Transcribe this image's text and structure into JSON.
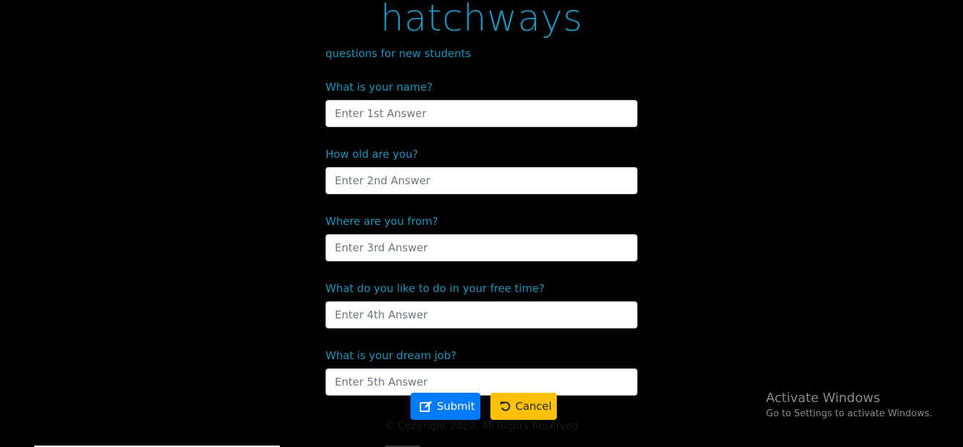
{
  "brand": {
    "title": "hatchways"
  },
  "form": {
    "subtitle": "questions for new students",
    "questions": [
      {
        "label": "What is your name?",
        "value": "",
        "placeholder": "Enter 1st Answer"
      },
      {
        "label": "How old are you?",
        "value": "",
        "placeholder": "Enter 2nd Answer"
      },
      {
        "label": "Where are you from?",
        "value": "",
        "placeholder": "Enter 3rd Answer"
      },
      {
        "label": "What do you like to do in your free time?",
        "value": "",
        "placeholder": "Enter 4th Answer"
      },
      {
        "label": "What is your dream job?",
        "value": "",
        "placeholder": "Enter 5th Answer"
      }
    ],
    "submit_label": "Submit",
    "submit_icon": "edit-icon",
    "cancel_label": "Cancel",
    "cancel_icon": "undo-icon"
  },
  "footer": {
    "copyright": "© Copyright 2020. All Rights Reserved"
  },
  "windows_watermark": {
    "title": "Activate Windows",
    "subtitle": "Go to Settings to activate Windows."
  },
  "colors": {
    "background": "#000000",
    "accent": "#1e93bd",
    "submit": "#007bff",
    "cancel": "#ffc107"
  }
}
